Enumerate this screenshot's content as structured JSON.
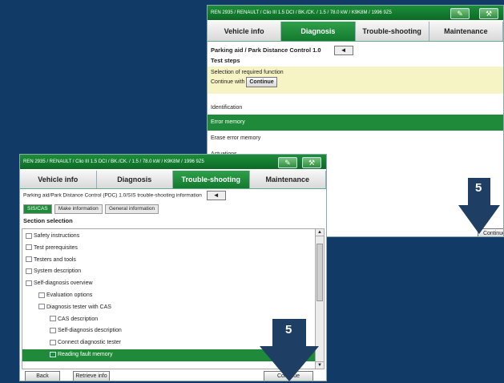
{
  "back_window": {
    "title": "REN 2935 / RENAULT / Clio III 1.5 DCI / BK./CK. / 1.5 / 78.0 kW / K9K8M / 1996 9Z5",
    "tabs": [
      "Vehicle info",
      "Diagnosis",
      "Trouble-shooting",
      "Maintenance"
    ],
    "active_tab": "Diagnosis",
    "heading": "Parking aid / Park Distance Control 1.0",
    "subheading": "Test steps",
    "back_button": "◄",
    "instruction_line1": "Selection of required function",
    "instruction_line2": "Continue with",
    "continue_inline": "Continue",
    "items": [
      "Identification",
      "Error memory",
      "Erase error memory",
      "Actuations"
    ],
    "selected_item": "Error memory",
    "continue_button": "Continue"
  },
  "front_window": {
    "title": "REN 2935 / RENAULT / Clio III 1.5 DCI / BK./CK. / 1.5 / 78.0 kW / K9K8M / 1996 9Z5",
    "tabs": [
      "Vehicle info",
      "Diagnosis",
      "Trouble-shooting",
      "Maintenance"
    ],
    "active_tab": "Trouble-shooting",
    "heading": "Parking aid/Park Distance Control (PDC) 1.0/SIS trouble-shooting information",
    "back_button": "◄",
    "subtabs": [
      "SIS/CAS",
      "Make information",
      "General information"
    ],
    "section_title": "Section selection",
    "tree": [
      {
        "label": "Safety instructions",
        "level": 0
      },
      {
        "label": "Test prerequisites",
        "level": 0
      },
      {
        "label": "Testers and tools",
        "level": 0
      },
      {
        "label": "System description",
        "level": 0
      },
      {
        "label": "Self-diagnosis overview",
        "level": 0
      },
      {
        "label": "Evaluation options",
        "level": 1
      },
      {
        "label": "Diagnosis tester with CAS",
        "level": 1
      },
      {
        "label": "CAS description",
        "level": 2
      },
      {
        "label": "Self-diagnosis description",
        "level": 2
      },
      {
        "label": "Connect diagnostic tester",
        "level": 2
      },
      {
        "label": "Reading fault memory",
        "level": 2
      }
    ],
    "selected_tree_item": "Reading fault memory",
    "buttons": {
      "back": "Back",
      "retrieve": "Retrieve info",
      "continue": "Continue"
    }
  },
  "callouts": [
    {
      "number": "5"
    },
    {
      "number": "5"
    }
  ],
  "colors": {
    "background": "#123a66",
    "accent": "#1f8a39",
    "highlight": "#f6f3c4",
    "arrow": "#1e3e63"
  }
}
